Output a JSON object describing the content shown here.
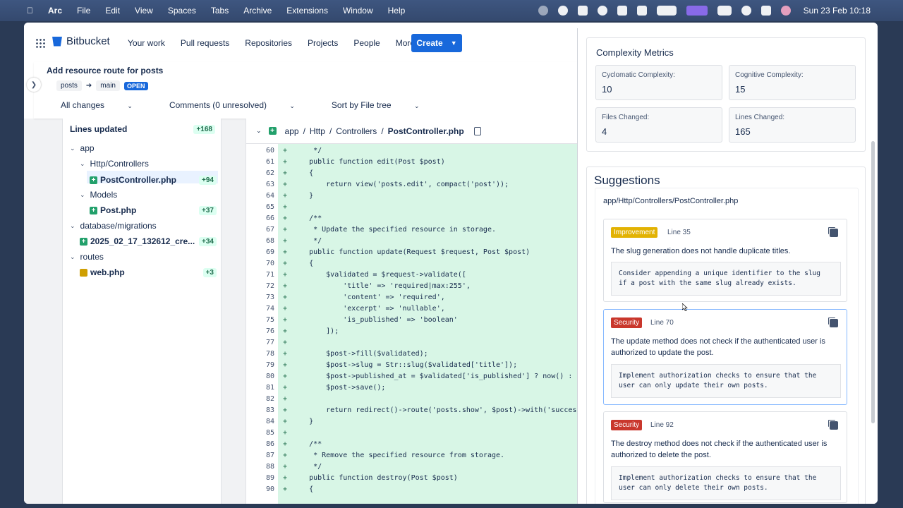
{
  "menubar": {
    "app": "Arc",
    "items": [
      "File",
      "Edit",
      "View",
      "Spaces",
      "Tabs",
      "Archive",
      "Extensions",
      "Window",
      "Help"
    ],
    "clock": "Sun 23 Feb  10:18"
  },
  "topbar": {
    "brand": "Bitbucket",
    "nav": [
      "Your work",
      "Pull requests",
      "Repositories",
      "Projects",
      "People",
      "More"
    ],
    "create": "Create"
  },
  "pr": {
    "title": "Add resource route for posts",
    "source_branch": "posts",
    "target_branch": "main",
    "status": "OPEN",
    "filters": [
      "All changes",
      "Comments (0 unresolved)",
      "Sort by File tree"
    ]
  },
  "tree": {
    "header": "Lines updated",
    "header_count": "+168",
    "items": [
      {
        "label": "app"
      },
      {
        "label": "Http/Controllers"
      },
      {
        "label": "PostController.php",
        "count": "+94"
      },
      {
        "label": "Models"
      },
      {
        "label": "Post.php",
        "count": "+37"
      },
      {
        "label": "database/migrations"
      },
      {
        "label": "2025_02_17_132612_cre...",
        "count": "+34"
      },
      {
        "label": "routes"
      },
      {
        "label": "web.php",
        "count": "+3"
      }
    ]
  },
  "code": {
    "path": [
      "app",
      "Http",
      "Controllers",
      "PostController.php"
    ],
    "lines": [
      {
        "n": "60",
        "t": "     */"
      },
      {
        "n": "61",
        "t": "    public function edit(Post $post)"
      },
      {
        "n": "62",
        "t": "    {"
      },
      {
        "n": "63",
        "t": "        return view('posts.edit', compact('post'));"
      },
      {
        "n": "64",
        "t": "    }"
      },
      {
        "n": "65",
        "t": ""
      },
      {
        "n": "66",
        "t": "    /**"
      },
      {
        "n": "67",
        "t": "     * Update the specified resource in storage."
      },
      {
        "n": "68",
        "t": "     */"
      },
      {
        "n": "69",
        "t": "    public function update(Request $request, Post $post)"
      },
      {
        "n": "70",
        "t": "    {"
      },
      {
        "n": "71",
        "t": "        $validated = $request->validate(["
      },
      {
        "n": "72",
        "t": "            'title' => 'required|max:255',"
      },
      {
        "n": "73",
        "t": "            'content' => 'required',"
      },
      {
        "n": "74",
        "t": "            'excerpt' => 'nullable',"
      },
      {
        "n": "75",
        "t": "            'is_published' => 'boolean'"
      },
      {
        "n": "76",
        "t": "        ]);"
      },
      {
        "n": "77",
        "t": ""
      },
      {
        "n": "78",
        "t": "        $post->fill($validated);"
      },
      {
        "n": "79",
        "t": "        $post->slug = Str::slug($validated['title']);"
      },
      {
        "n": "80",
        "t": "        $post->published_at = $validated['is_published'] ? now() : nul"
      },
      {
        "n": "81",
        "t": "        $post->save();"
      },
      {
        "n": "82",
        "t": ""
      },
      {
        "n": "83",
        "t": "        return redirect()->route('posts.show', $post)->with('success',"
      },
      {
        "n": "84",
        "t": "    }"
      },
      {
        "n": "85",
        "t": ""
      },
      {
        "n": "86",
        "t": "    /**"
      },
      {
        "n": "87",
        "t": "     * Remove the specified resource from storage."
      },
      {
        "n": "88",
        "t": "     */"
      },
      {
        "n": "89",
        "t": "    public function destroy(Post $post)"
      },
      {
        "n": "90",
        "t": "    {"
      }
    ]
  },
  "metrics": {
    "title": "Complexity Metrics",
    "items": [
      {
        "label": "Cyclomatic Complexity:",
        "value": "10"
      },
      {
        "label": "Cognitive Complexity:",
        "value": "15"
      },
      {
        "label": "Files Changed:",
        "value": "4"
      },
      {
        "label": "Lines Changed:",
        "value": "165"
      }
    ]
  },
  "suggestions": {
    "title": "Suggestions",
    "file": "app/Http/Controllers/PostController.php",
    "items": [
      {
        "tag": "Improvement",
        "line": "Line 35",
        "text": "The slug generation does not handle duplicate titles.",
        "code": "Consider appending a unique identifier to the slug\nif a post with the same slug already exists."
      },
      {
        "tag": "Security",
        "line": "Line 70",
        "text": "The update method does not check if the authenticated user is authorized to update the post.",
        "code": "Implement authorization checks to ensure that the\nuser can only update their own posts."
      },
      {
        "tag": "Security",
        "line": "Line 92",
        "text": "The destroy method does not check if the authenticated user is authorized to delete the post.",
        "code": "Implement authorization checks to ensure that the\nuser can only delete their own posts."
      }
    ]
  },
  "colors": {
    "brand_blue": "#1868db",
    "added_bg": "#d8f6e6",
    "security": "#c9372c",
    "improvement": "#e2b203"
  }
}
